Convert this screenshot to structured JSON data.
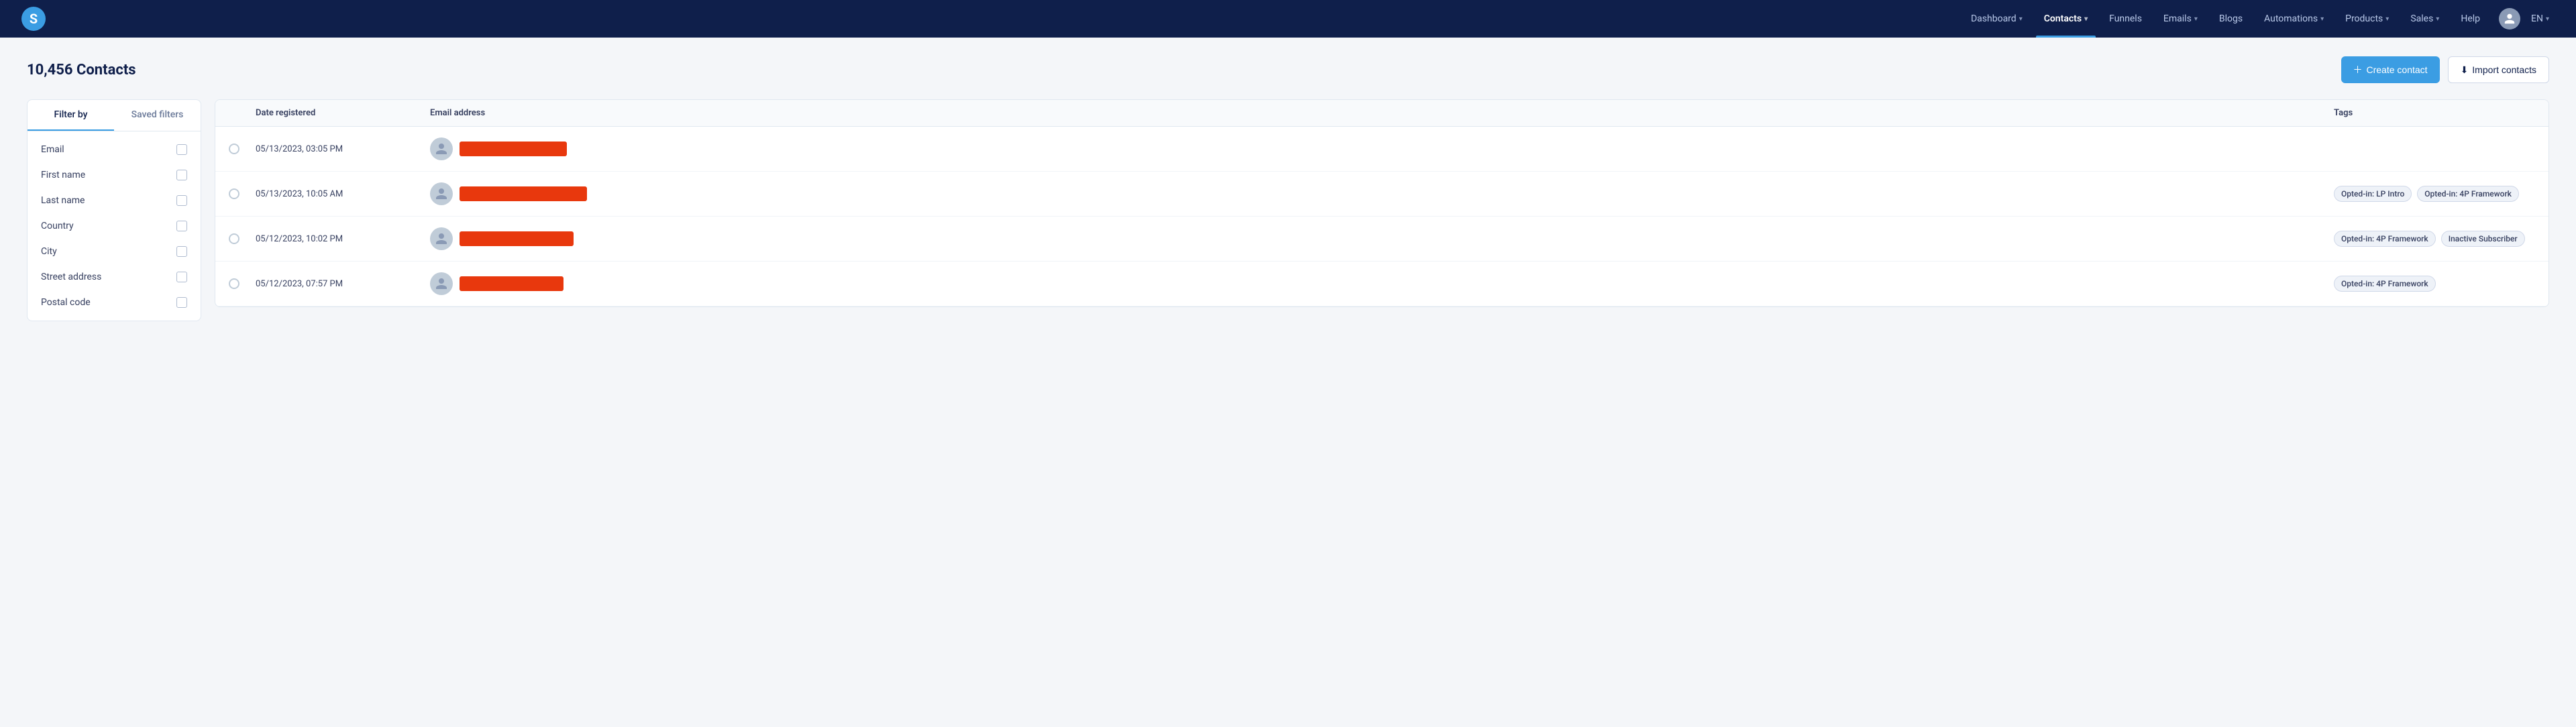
{
  "app": {
    "logo_letter": "S"
  },
  "navbar": {
    "items": [
      {
        "id": "dashboard",
        "label": "Dashboard",
        "has_dropdown": true,
        "active": false
      },
      {
        "id": "contacts",
        "label": "Contacts",
        "has_dropdown": true,
        "active": true
      },
      {
        "id": "funnels",
        "label": "Funnels",
        "has_dropdown": false,
        "active": false
      },
      {
        "id": "emails",
        "label": "Emails",
        "has_dropdown": true,
        "active": false
      },
      {
        "id": "blogs",
        "label": "Blogs",
        "has_dropdown": false,
        "active": false
      },
      {
        "id": "automations",
        "label": "Automations",
        "has_dropdown": true,
        "active": false
      },
      {
        "id": "products",
        "label": "Products",
        "has_dropdown": true,
        "active": false
      },
      {
        "id": "sales",
        "label": "Sales",
        "has_dropdown": true,
        "active": false
      },
      {
        "id": "help",
        "label": "Help",
        "has_dropdown": false,
        "active": false
      }
    ],
    "lang": "EN"
  },
  "page": {
    "title": "10,456 Contacts",
    "create_button": "Create contact",
    "import_button": "Import contacts"
  },
  "sidebar": {
    "tab_filter": "Filter by",
    "tab_saved": "Saved filters",
    "filters": [
      {
        "id": "email",
        "label": "Email"
      },
      {
        "id": "first_name",
        "label": "First name"
      },
      {
        "id": "last_name",
        "label": "Last name"
      },
      {
        "id": "country",
        "label": "Country"
      },
      {
        "id": "city",
        "label": "City"
      },
      {
        "id": "street_address",
        "label": "Street address"
      },
      {
        "id": "postal_code",
        "label": "Postal code"
      }
    ]
  },
  "table": {
    "columns": [
      "Date registered",
      "Email address",
      "Tags"
    ],
    "rows": [
      {
        "id": 1,
        "date": "05/13/2023, 03:05 PM",
        "email_width": 160,
        "tags": []
      },
      {
        "id": 2,
        "date": "05/13/2023, 10:05 AM",
        "email_width": 190,
        "tags": [
          "Opted-in: LP Intro",
          "Opted-in: 4P Framework"
        ]
      },
      {
        "id": 3,
        "date": "05/12/2023, 10:02 PM",
        "email_width": 170,
        "tags": [
          "Opted-in: 4P Framework",
          "Inactive Subscriber"
        ]
      },
      {
        "id": 4,
        "date": "05/12/2023, 07:57 PM",
        "email_width": 155,
        "tags": [
          "Opted-in: 4P Framework"
        ]
      }
    ]
  }
}
